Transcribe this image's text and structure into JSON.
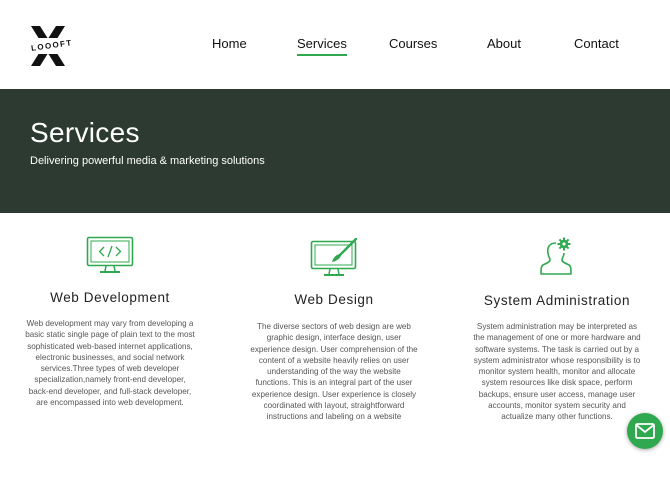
{
  "brand": {
    "logo_text": "LOOOFT"
  },
  "nav": {
    "items": [
      {
        "label": "Home"
      },
      {
        "label": "Services"
      },
      {
        "label": "Courses"
      },
      {
        "label": "About"
      },
      {
        "label": "Contact"
      }
    ],
    "active": "Services"
  },
  "hero": {
    "title": "Services",
    "subtitle": "Delivering powerful media & marketing solutions"
  },
  "services": [
    {
      "icon": "code-monitor-icon",
      "title": "Web Development",
      "description": "Web development may vary from developing a basic static single page of plain text to the most sophisticated web-based internet applications, electronic businesses, and social network services.Three types of web developer specialization,namely front-end developer, back-end developer, and full-stack developer, are encompassed into web development."
    },
    {
      "icon": "design-monitor-icon",
      "title": "Web Design",
      "description": "The diverse sectors of web design are web graphic design, interface design, user experience design. User comprehension of the content of a website heavily relies on user understanding of the way the website functions. This is an integral part of the user experience design. User experience is closely coordinated with layout, straightforward instructions and labeling on a website"
    },
    {
      "icon": "user-gear-icon",
      "title": "System Administration",
      "description": "System administration may be interpreted as the management of one or more hardware and software systems. The task is carried out by a system administrator whose responsibility is to monitor system health, monitor and allocate system resources like disk space, perform backups, ensure user access, manage user accounts, monitor system security and actualize many other functions."
    }
  ],
  "colors": {
    "accent": "#2fa84f",
    "hero_bg": "#2c3a31",
    "text": "#333333"
  },
  "floating_button": {
    "icon": "mail-icon"
  }
}
